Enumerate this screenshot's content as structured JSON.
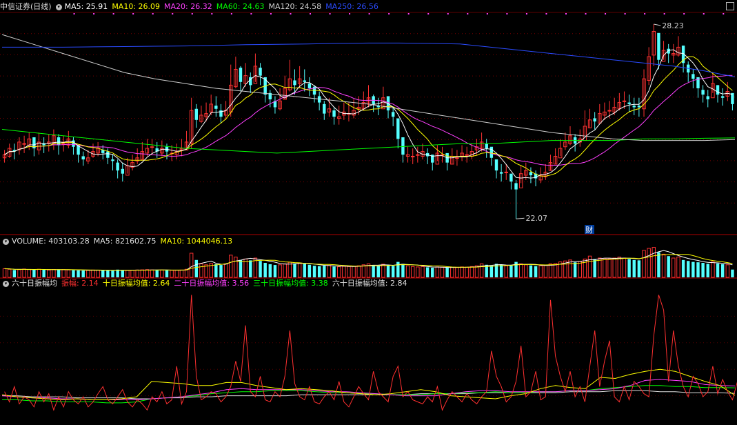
{
  "header": {
    "title": "中信证券(日线)",
    "ma_items": [
      {
        "label": "MA5: 25.91",
        "color": "#ffffff"
      },
      {
        "label": "MA10: 26.09",
        "color": "#ffff00"
      },
      {
        "label": "MA20: 26.32",
        "color": "#ff40ff"
      },
      {
        "label": "MA60: 24.63",
        "color": "#00ff00"
      },
      {
        "label": "MA120: 24.58",
        "color": "#d0d0d0"
      },
      {
        "label": "MA250: 26.56",
        "color": "#2a4bff"
      }
    ]
  },
  "volume_legend": {
    "title": "VOLUME: 403103.28",
    "items": [
      {
        "label": "MA5: 821602.75",
        "color": "#e0e0e0"
      },
      {
        "label": "MA10: 1044046.13",
        "color": "#ffff00"
      }
    ]
  },
  "amp_legend": {
    "title": "六十日振幅均",
    "items": [
      {
        "label": "振幅: 2.14",
        "color": "#ff3030"
      },
      {
        "label": "十日振幅均值: 2.64",
        "color": "#ffff00"
      },
      {
        "label": "二十日振幅均值: 3.56",
        "color": "#ff40ff"
      },
      {
        "label": "三十日振幅均值: 3.38",
        "color": "#00ff00"
      },
      {
        "label": "六十日振幅均值: 2.84",
        "color": "#e0e0e0"
      }
    ]
  },
  "annotations": {
    "high_label": "28.23",
    "low_label": "22.07",
    "fin_marker": "财"
  },
  "chart_data": {
    "type": "candlestick",
    "price_high": 28.23,
    "price_low": 22.07,
    "colors": {
      "up": "#ff3232",
      "down": "#54ffff",
      "ma5": "#ffffff",
      "ma10": "#ffff00",
      "ma20": "#ff40ff",
      "ma60": "#00ff00",
      "ma120": "#d0d0d0",
      "ma250": "#2a4bff",
      "amp": "#ff3030",
      "amp10": "#ffff00",
      "amp20": "#ff40ff",
      "amp30": "#00ff00",
      "amp60": "#e0e0e0"
    },
    "close": [
      24.1,
      24.3,
      24.2,
      24.5,
      24.45,
      24.6,
      24.3,
      24.5,
      24.4,
      24.5,
      24.7,
      24.4,
      24.45,
      24.6,
      24.35,
      24.1,
      23.95,
      24.0,
      24.2,
      24.3,
      24.15,
      24.0,
      23.9,
      23.6,
      23.5,
      23.75,
      23.85,
      24.0,
      24.2,
      24.3,
      24.35,
      24.2,
      24.3,
      24.2,
      24.15,
      24.2,
      24.3,
      24.5,
      25.5,
      25.2,
      25.35,
      25.4,
      25.7,
      25.55,
      25.3,
      25.5,
      26.3,
      26.8,
      26.4,
      26.6,
      26.3,
      26.9,
      26.6,
      26.0,
      25.85,
      25.6,
      25.8,
      26.2,
      26.5,
      26.3,
      26.5,
      26.4,
      26.2,
      26.0,
      25.75,
      25.4,
      25.55,
      25.3,
      25.3,
      25.45,
      25.4,
      25.5,
      25.6,
      25.75,
      25.9,
      25.7,
      25.6,
      25.9,
      25.5,
      25.3,
      24.6,
      24.1,
      24.1,
      24.05,
      24.1,
      24.2,
      24.05,
      23.85,
      24.15,
      24.1,
      23.85,
      24.05,
      24.0,
      24.15,
      24.1,
      24.2,
      24.35,
      24.5,
      24.3,
      24.0,
      23.6,
      23.5,
      23.55,
      23.25,
      23.0,
      23.5,
      23.6,
      23.45,
      23.35,
      23.45,
      23.55,
      23.85,
      24.05,
      24.3,
      24.5,
      24.7,
      24.45,
      24.6,
      25.0,
      25.2,
      25.15,
      25.4,
      25.45,
      25.5,
      25.6,
      25.75,
      25.8,
      25.7,
      25.6,
      25.6,
      26.5,
      27.2,
      28.0,
      27.1,
      27.4,
      27.3,
      27.3,
      27.5,
      27.0,
      26.7,
      26.5,
      26.2,
      26.0,
      25.85,
      26.35,
      26.0,
      25.9,
      26.1,
      25.7
    ],
    "hl": [
      [
        23.85,
        24.25
      ],
      [
        24.0,
        24.45
      ],
      [
        23.95,
        24.45
      ],
      [
        24.1,
        24.65
      ],
      [
        24.15,
        24.7
      ],
      [
        24.25,
        24.8
      ],
      [
        24.05,
        24.6
      ],
      [
        24.1,
        24.8
      ],
      [
        24.15,
        24.65
      ],
      [
        24.2,
        24.75
      ],
      [
        24.25,
        24.9
      ],
      [
        24.1,
        24.75
      ],
      [
        24.2,
        24.7
      ],
      [
        24.3,
        24.85
      ],
      [
        24.1,
        24.65
      ],
      [
        23.85,
        24.4
      ],
      [
        23.75,
        24.2
      ],
      [
        23.8,
        24.25
      ],
      [
        24.0,
        24.45
      ],
      [
        24.05,
        24.5
      ],
      [
        23.95,
        24.4
      ],
      [
        23.8,
        24.3
      ],
      [
        23.6,
        24.1
      ],
      [
        23.35,
        23.95
      ],
      [
        23.25,
        23.85
      ],
      [
        23.5,
        24.0
      ],
      [
        23.6,
        24.1
      ],
      [
        23.8,
        24.3
      ],
      [
        23.95,
        24.5
      ],
      [
        24.05,
        24.6
      ],
      [
        24.1,
        24.6
      ],
      [
        24.0,
        24.5
      ],
      [
        24.05,
        24.55
      ],
      [
        23.95,
        24.45
      ],
      [
        23.9,
        24.4
      ],
      [
        23.95,
        24.45
      ],
      [
        24.05,
        24.6
      ],
      [
        24.25,
        24.85
      ],
      [
        24.3,
        25.9
      ],
      [
        24.95,
        25.7
      ],
      [
        25.1,
        25.65
      ],
      [
        25.15,
        25.75
      ],
      [
        25.35,
        26.0
      ],
      [
        25.3,
        25.95
      ],
      [
        25.1,
        25.7
      ],
      [
        25.2,
        25.8
      ],
      [
        25.3,
        26.95
      ],
      [
        26.2,
        27.2
      ],
      [
        26.1,
        26.9
      ],
      [
        26.25,
        27.0
      ],
      [
        26.05,
        26.7
      ],
      [
        26.4,
        27.3
      ],
      [
        26.3,
        27.0
      ],
      [
        25.75,
        26.4
      ],
      [
        25.6,
        26.15
      ],
      [
        25.4,
        25.95
      ],
      [
        25.5,
        26.2
      ],
      [
        25.85,
        26.6
      ],
      [
        26.1,
        27.1
      ],
      [
        26.0,
        26.8
      ],
      [
        26.2,
        26.9
      ],
      [
        26.1,
        26.8
      ],
      [
        25.95,
        26.55
      ],
      [
        25.75,
        26.3
      ],
      [
        25.5,
        26.1
      ],
      [
        25.2,
        25.8
      ],
      [
        25.3,
        25.9
      ],
      [
        25.05,
        25.6
      ],
      [
        25.05,
        25.65
      ],
      [
        25.2,
        25.75
      ],
      [
        25.15,
        25.75
      ],
      [
        25.25,
        25.85
      ],
      [
        25.35,
        25.95
      ],
      [
        25.5,
        26.1
      ],
      [
        25.6,
        26.3
      ],
      [
        25.45,
        26.0
      ],
      [
        25.35,
        25.9
      ],
      [
        25.6,
        26.25
      ],
      [
        25.25,
        25.85
      ],
      [
        25.0,
        25.6
      ],
      [
        24.3,
        25.0
      ],
      [
        23.85,
        24.5
      ],
      [
        23.85,
        24.35
      ],
      [
        23.8,
        24.3
      ],
      [
        23.85,
        24.35
      ],
      [
        23.95,
        24.45
      ],
      [
        23.8,
        24.3
      ],
      [
        23.6,
        24.1
      ],
      [
        23.9,
        24.4
      ],
      [
        23.85,
        24.35
      ],
      [
        23.6,
        24.1
      ],
      [
        23.8,
        24.3
      ],
      [
        23.75,
        24.25
      ],
      [
        23.9,
        24.4
      ],
      [
        23.85,
        24.35
      ],
      [
        23.95,
        24.45
      ],
      [
        24.1,
        24.6
      ],
      [
        24.2,
        24.8
      ],
      [
        24.0,
        24.6
      ],
      [
        23.75,
        24.3
      ],
      [
        23.35,
        23.9
      ],
      [
        23.25,
        23.8
      ],
      [
        23.3,
        23.8
      ],
      [
        23.0,
        23.5
      ],
      [
        22.07,
        23.3
      ],
      [
        23.2,
        23.75
      ],
      [
        23.3,
        23.85
      ],
      [
        23.2,
        23.7
      ],
      [
        23.1,
        23.6
      ],
      [
        23.2,
        23.7
      ],
      [
        23.3,
        23.8
      ],
      [
        23.6,
        24.1
      ],
      [
        23.8,
        24.3
      ],
      [
        24.05,
        24.6
      ],
      [
        24.25,
        24.8
      ],
      [
        24.4,
        25.0
      ],
      [
        24.2,
        24.75
      ],
      [
        24.35,
        24.9
      ],
      [
        24.7,
        25.5
      ],
      [
        24.95,
        25.55
      ],
      [
        24.9,
        25.45
      ],
      [
        25.1,
        25.7
      ],
      [
        25.2,
        25.75
      ],
      [
        25.25,
        25.8
      ],
      [
        25.35,
        25.9
      ],
      [
        25.5,
        26.05
      ],
      [
        25.55,
        26.1
      ],
      [
        25.45,
        26.0
      ],
      [
        25.35,
        25.9
      ],
      [
        25.3,
        25.9
      ],
      [
        25.3,
        26.8
      ],
      [
        26.3,
        27.5
      ],
      [
        26.9,
        28.23
      ],
      [
        26.8,
        27.5
      ],
      [
        27.1,
        27.7
      ],
      [
        27.0,
        27.6
      ],
      [
        27.0,
        27.6
      ],
      [
        27.2,
        27.85
      ],
      [
        26.7,
        27.35
      ],
      [
        26.4,
        27.05
      ],
      [
        26.2,
        26.8
      ],
      [
        25.9,
        26.5
      ],
      [
        25.75,
        26.3
      ],
      [
        25.6,
        26.15
      ],
      [
        26.05,
        26.7
      ],
      [
        25.75,
        26.3
      ],
      [
        25.65,
        26.2
      ],
      [
        25.8,
        26.4
      ],
      [
        25.5,
        26.0
      ]
    ],
    "ma60_curve": [
      24.9,
      24.8,
      24.7,
      24.6,
      24.5,
      24.4,
      24.3,
      24.25,
      24.2,
      24.15,
      24.2,
      24.25,
      24.3,
      24.35,
      24.4,
      24.45,
      24.45,
      24.5,
      24.55,
      24.55,
      24.55,
      24.6,
      24.6,
      24.62,
      24.63
    ],
    "ma120_curve": [
      27.9,
      27.6,
      27.3,
      27.0,
      26.7,
      26.5,
      26.35,
      26.2,
      26.1,
      26.0,
      25.9,
      25.8,
      25.7,
      25.55,
      25.4,
      25.25,
      25.1,
      24.95,
      24.8,
      24.7,
      24.6,
      24.55,
      24.55,
      24.55,
      24.58
    ],
    "ma250_curve": [
      27.5,
      27.5,
      27.5,
      27.51,
      27.52,
      27.53,
      27.54,
      27.56,
      27.58,
      27.59,
      27.6,
      27.62,
      27.63,
      27.63,
      27.62,
      27.6,
      27.5,
      27.4,
      27.3,
      27.2,
      27.1,
      27.0,
      26.9,
      26.75,
      26.56
    ],
    "volume_max": 1500000,
    "volume": [
      450000,
      420000,
      380000,
      400000,
      430000,
      410000,
      390000,
      420000,
      400000,
      380000,
      410000,
      395000,
      405000,
      385000,
      370000,
      360000,
      350000,
      365000,
      380000,
      375000,
      360000,
      355000,
      340000,
      400000,
      380000,
      360000,
      370000,
      380000,
      390000,
      400000,
      385000,
      375000,
      380000,
      370000,
      365000,
      370000,
      380000,
      420000,
      1250000,
      900000,
      700000,
      650000,
      720000,
      680000,
      640000,
      700000,
      1150000,
      1050000,
      900000,
      950000,
      880000,
      1000000,
      850000,
      750000,
      680000,
      640000,
      650000,
      700000,
      780000,
      720000,
      750000,
      700000,
      650000,
      600000,
      580000,
      600000,
      620000,
      560000,
      550000,
      570000,
      560000,
      580000,
      600000,
      650000,
      700000,
      620000,
      600000,
      680000,
      620000,
      600000,
      800000,
      700000,
      600000,
      560000,
      540000,
      560000,
      520000,
      500000,
      540000,
      520000,
      500000,
      520000,
      510000,
      540000,
      530000,
      560000,
      600000,
      700000,
      650000,
      600000,
      700000,
      650000,
      600000,
      620000,
      800000,
      700000,
      650000,
      620000,
      580000,
      600000,
      620000,
      700000,
      720000,
      800000,
      850000,
      900000,
      780000,
      820000,
      950000,
      1100000,
      950000,
      1000000,
      980000,
      960000,
      1000000,
      1050000,
      1000000,
      950000,
      900000,
      880000,
      1400000,
      1500000,
      1550000,
      1300000,
      1200000,
      1100000,
      1000000,
      1050000,
      900000,
      850000,
      800000,
      780000,
      750000,
      700000,
      800000,
      720000,
      680000,
      650000,
      403103
    ],
    "amp": [
      3.0,
      2.0,
      3.5,
      1.8,
      2.5,
      2.2,
      1.5,
      3.0,
      2.0,
      2.8,
      1.2,
      2.5,
      1.5,
      3.0,
      2.2,
      1.8,
      2.5,
      1.5,
      2.0,
      2.8,
      3.5,
      2.2,
      1.8,
      2.5,
      3.2,
      2.0,
      1.5,
      2.2,
      1.8,
      1.2,
      2.5,
      2.0,
      3.0,
      1.8,
      2.2,
      5.5,
      1.8,
      3.0,
      12.5,
      4.5,
      2.2,
      2.5,
      3.0,
      2.8,
      2.0,
      2.5,
      3.5,
      6.0,
      4.0,
      9.5,
      3.0,
      2.5,
      4.5,
      2.2,
      2.0,
      3.0,
      2.5,
      4.5,
      9.0,
      3.8,
      2.5,
      2.2,
      3.5,
      2.0,
      1.8,
      2.5,
      3.0,
      2.2,
      4.0,
      2.0,
      1.5,
      2.5,
      3.5,
      2.8,
      2.2,
      5.0,
      3.0,
      2.5,
      2.0,
      4.5,
      5.5,
      2.5,
      3.0,
      2.2,
      2.0,
      1.8,
      2.5,
      2.0,
      3.5,
      1.2,
      2.2,
      3.0,
      2.5,
      2.0,
      2.8,
      2.2,
      1.8,
      2.5,
      3.0,
      7.0,
      4.5,
      3.5,
      2.0,
      2.5,
      4.0,
      7.5,
      2.5,
      3.0,
      5.0,
      2.2,
      2.5,
      12.0,
      6.5,
      4.5,
      3.0,
      5.0,
      2.5,
      3.5,
      2.0,
      5.5,
      9.0,
      3.5,
      6.0,
      8.0,
      2.5,
      2.0,
      3.5,
      2.2,
      4.0,
      3.5,
      2.8,
      2.5,
      8.5,
      12.5,
      11.0,
      4.0,
      9.0,
      5.5,
      3.5,
      2.5,
      4.5,
      3.8,
      2.5,
      3.0,
      5.5,
      2.8,
      4.2,
      3.0,
      2.2,
      4.0,
      2.14
    ],
    "amp10_curve": [
      2.7,
      2.5,
      2.4,
      2.3,
      2.2,
      2.3,
      2.2,
      2.2,
      2.3,
      2.5,
      4.0,
      3.9,
      3.8,
      3.6,
      3.6,
      3.9,
      3.9,
      3.6,
      3.4,
      3.2,
      3.3,
      3.2,
      3.1,
      2.9,
      2.8,
      2.7,
      2.8,
      3.0,
      3.2,
      3.0,
      2.6,
      2.5,
      2.4,
      2.3,
      2.6,
      2.8,
      3.3,
      3.6,
      3.4,
      3.3,
      4.4,
      4.3,
      4.7,
      5.0,
      5.2,
      5.0,
      4.5,
      4.0,
      3.6,
      2.64
    ],
    "amp20_curve": [
      2.6,
      2.5,
      2.4,
      2.4,
      2.3,
      2.3,
      2.2,
      2.2,
      2.2,
      2.2,
      2.3,
      2.4,
      2.5,
      2.7,
      2.9,
      3.2,
      3.3,
      3.2,
      3.2,
      3.2,
      3.2,
      3.1,
      3.0,
      3.0,
      2.9,
      2.8,
      2.7,
      2.6,
      2.6,
      2.6,
      2.8,
      3.0,
      3.1,
      3.1,
      3.0,
      3.0,
      3.0,
      3.0,
      3.1,
      3.1,
      3.2,
      3.3,
      3.6,
      4.1,
      4.2,
      4.1,
      4.0,
      3.7,
      3.6,
      3.56
    ],
    "amp30_curve": [
      2.2,
      2.2,
      2.1,
      2.1,
      2.0,
      2.0,
      2.0,
      1.9,
      1.9,
      2.0,
      2.3,
      2.4,
      2.5,
      2.6,
      2.8,
      2.9,
      3.0,
      3.0,
      3.1,
      3.1,
      3.1,
      3.0,
      2.9,
      2.9,
      2.8,
      2.8,
      2.7,
      2.7,
      2.7,
      2.8,
      2.8,
      2.9,
      2.9,
      3.0,
      2.9,
      2.9,
      3.0,
      3.0,
      3.1,
      3.1,
      3.3,
      3.4,
      3.5,
      3.6,
      3.6,
      3.5,
      3.5,
      3.4,
      3.4,
      3.38
    ],
    "amp60_curve": [
      2.6,
      2.6,
      2.5,
      2.5,
      2.5,
      2.4,
      2.4,
      2.4,
      2.4,
      2.3,
      2.3,
      2.4,
      2.4,
      2.5,
      2.5,
      2.6,
      2.6,
      2.6,
      2.6,
      2.6,
      2.7,
      2.7,
      2.7,
      2.7,
      2.7,
      2.7,
      2.7,
      2.7,
      2.8,
      2.8,
      2.8,
      2.8,
      2.9,
      2.9,
      2.9,
      2.9,
      2.9,
      2.9,
      3.0,
      3.0,
      3.0,
      3.1,
      3.1,
      3.1,
      3.0,
      3.0,
      2.9,
      2.9,
      2.9,
      2.84
    ],
    "amp_max": 13.0
  }
}
